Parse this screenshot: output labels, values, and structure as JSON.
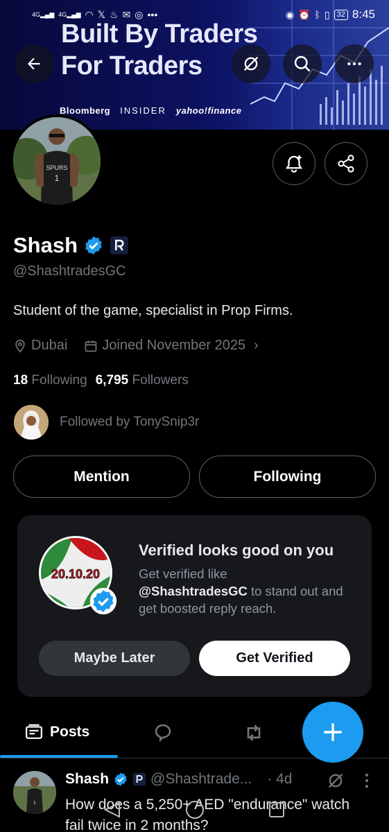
{
  "status_bar": {
    "signal_left": "4G",
    "signal_right": "4G",
    "battery": "32",
    "time": "8:45"
  },
  "banner": {
    "headline_line1": "Built By Traders",
    "headline_line2": "For Traders",
    "media": [
      "Bloomberg",
      "INSIDER",
      "yahoo!finance"
    ]
  },
  "profile": {
    "name": "Shash",
    "handle": "@ShashtradesGC",
    "bio": "Student of the game, specialist in Prop Firms.",
    "location": "Dubai",
    "joined": "Joined November 2025",
    "following_count": "18",
    "following_label": "Following",
    "followers_count": "6,795",
    "followers_label": "Followers",
    "followed_by": "Followed by TonySnip3r"
  },
  "actions": {
    "mention": "Mention",
    "following": "Following"
  },
  "promo": {
    "title": "Verified looks good on you",
    "line1": "Get verified like",
    "handle": "@ShashtradesGC",
    "line2": " to stand out and get boosted reply reach.",
    "avatar_text": "20.10.20",
    "maybe_later": "Maybe Later",
    "get_verified": "Get Verified"
  },
  "tabs": {
    "posts": "Posts"
  },
  "post": {
    "name": "Shash",
    "handle": "@Shashtrade...",
    "time": "· 4d",
    "text": "How does a 5,250+ AED \"endurance\" watch fail twice in 2 months?"
  },
  "colors": {
    "accent": "#1d9bf0",
    "background": "#000000",
    "card": "#16181c",
    "muted_text": "#71767b",
    "border": "#536471"
  },
  "icons": [
    "back-arrow-icon",
    "grok-icon",
    "search-icon",
    "more-icon",
    "notification-bell-icon",
    "share-icon",
    "verified-badge-icon",
    "location-icon",
    "calendar-icon",
    "posts-icon",
    "reply-icon",
    "repost-icon",
    "plus-icon"
  ]
}
